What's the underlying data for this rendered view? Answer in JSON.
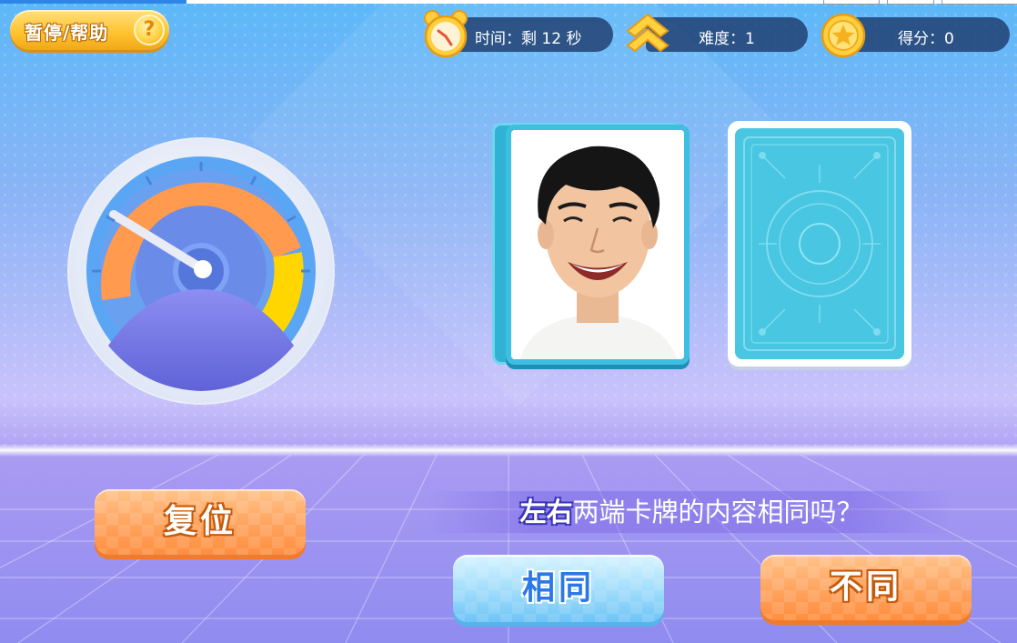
{
  "hud": {
    "pause_help_label": "暂停/帮助",
    "help_glyph": "?",
    "timer_text": "时间：剩 12 秒",
    "difficulty_text": "难度：1",
    "score_text": "得分：0"
  },
  "gauge": {
    "zones": [
      "blue",
      "orange",
      "yellow"
    ]
  },
  "cards": {
    "left": "face-photo",
    "right": "card-back"
  },
  "question": {
    "highlight": "左右",
    "text": "两端卡牌的内容相同吗？"
  },
  "buttons": {
    "reset": "复位",
    "same": "相同",
    "different": "不同"
  },
  "colors": {
    "orange_button": "#ff9f55",
    "blue_button": "#9fdcfb",
    "pill_bg": "#1e3c6e",
    "gold": "#ffc22e"
  }
}
